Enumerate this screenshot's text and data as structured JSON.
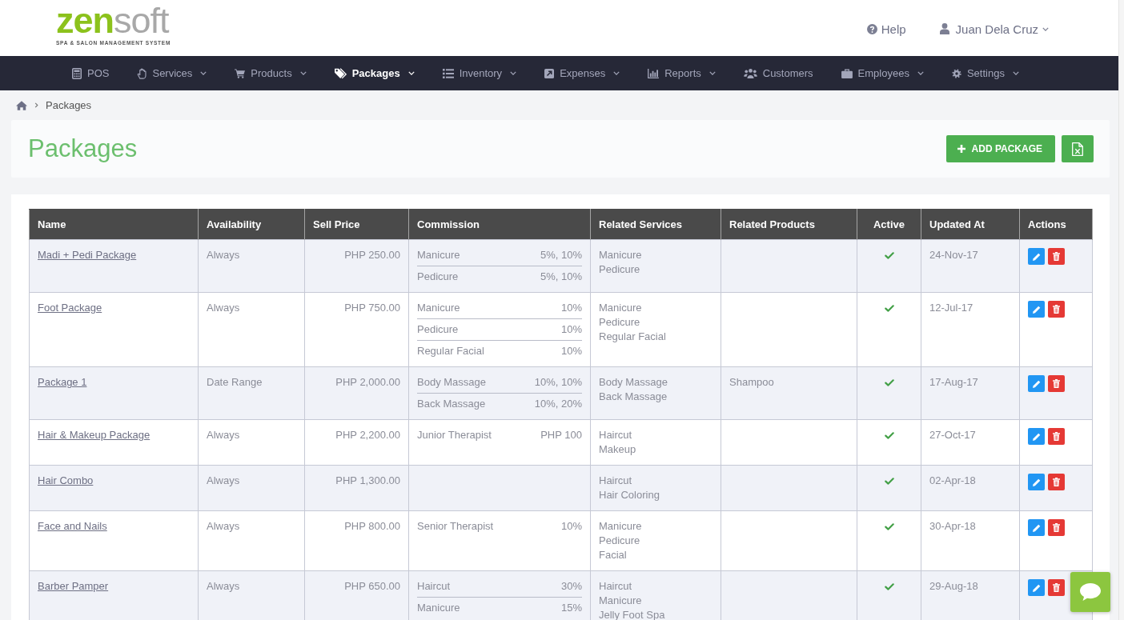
{
  "header": {
    "logo": {
      "parts": [
        "zen",
        "soft"
      ],
      "tagline": "SPA & SALON MANAGEMENT SYSTEM"
    },
    "help": "Help",
    "user": "Juan Dela Cruz"
  },
  "nav": [
    {
      "label": "POS",
      "has_menu": false,
      "selected": false
    },
    {
      "label": "Services",
      "has_menu": true,
      "selected": false
    },
    {
      "label": "Products",
      "has_menu": true,
      "selected": false
    },
    {
      "label": "Packages",
      "has_menu": true,
      "selected": true
    },
    {
      "label": "Inventory",
      "has_menu": true,
      "selected": false
    },
    {
      "label": "Expenses",
      "has_menu": true,
      "selected": false
    },
    {
      "label": "Reports",
      "has_menu": true,
      "selected": false
    },
    {
      "label": "Customers",
      "has_menu": false,
      "selected": false
    },
    {
      "label": "Employees",
      "has_menu": true,
      "selected": false
    },
    {
      "label": "Settings",
      "has_menu": true,
      "selected": false
    }
  ],
  "breadcrumb": {
    "current": "Packages"
  },
  "page": {
    "title": "Packages",
    "add_button": "ADD PACKAGE"
  },
  "table": {
    "columns": [
      "Name",
      "Availability",
      "Sell Price",
      "Commission",
      "Related Services",
      "Related Products",
      "Active",
      "Updated At",
      "Actions"
    ],
    "rows": [
      {
        "name": "Madi + Pedi Package",
        "availability": "Always",
        "sell_price": "PHP 250.00",
        "commission": [
          {
            "label": "Manicure",
            "value": "5%, 10%"
          },
          {
            "label": "Pedicure",
            "value": "5%, 10%"
          }
        ],
        "related_services": [
          "Manicure",
          "Pedicure"
        ],
        "active": true,
        "updated_at": "24-Nov-17"
      },
      {
        "name": "Foot Package",
        "availability": "Always",
        "sell_price": "PHP 750.00",
        "commission": [
          {
            "label": "Manicure",
            "value": "10%"
          },
          {
            "label": "Pedicure",
            "value": "10%"
          },
          {
            "label": "Regular Facial",
            "value": "10%"
          }
        ],
        "related_services": [
          "Manicure",
          "Pedicure",
          "Regular Facial"
        ],
        "active": true,
        "updated_at": "12-Jul-17"
      },
      {
        "name": "Package 1",
        "availability": "Date Range",
        "sell_price": "PHP 2,000.00",
        "commission": [
          {
            "label": "Body Massage",
            "value": "10%, 10%"
          },
          {
            "label": "Back Massage",
            "value": "10%, 20%"
          }
        ],
        "related_services": [
          "Body Massage",
          "Back Massage"
        ],
        "related_products": [
          "Shampoo"
        ],
        "active": true,
        "updated_at": "17-Aug-17"
      },
      {
        "name": "Hair & Makeup Package",
        "availability": "Always",
        "sell_price": "PHP 2,200.00",
        "commission": [
          {
            "label": "Junior Therapist",
            "value": "PHP 100"
          }
        ],
        "related_services": [
          "Haircut",
          "Makeup"
        ],
        "active": true,
        "updated_at": "27-Oct-17"
      },
      {
        "name": "Hair Combo",
        "availability": "Always",
        "sell_price": "PHP 1,300.00",
        "related_services": [
          "Haircut",
          "Hair Coloring"
        ],
        "active": true,
        "updated_at": "02-Apr-18"
      },
      {
        "name": "Face and Nails",
        "availability": "Always",
        "sell_price": "PHP 800.00",
        "commission": [
          {
            "label": "Senior Therapist",
            "value": "10%"
          }
        ],
        "related_services": [
          "Manicure",
          "Pedicure",
          "Facial"
        ],
        "active": true,
        "updated_at": "30-Apr-18"
      },
      {
        "name": "Barber Pamper",
        "availability": "Always",
        "sell_price": "PHP 650.00",
        "commission": [
          {
            "label": "Haircut",
            "value": "30%"
          },
          {
            "label": "Manicure",
            "value": "15%"
          }
        ],
        "related_services": [
          "Haircut",
          "Manicure",
          "Jelly Foot Spa"
        ],
        "active": true,
        "updated_at": "29-Aug-18"
      }
    ]
  }
}
